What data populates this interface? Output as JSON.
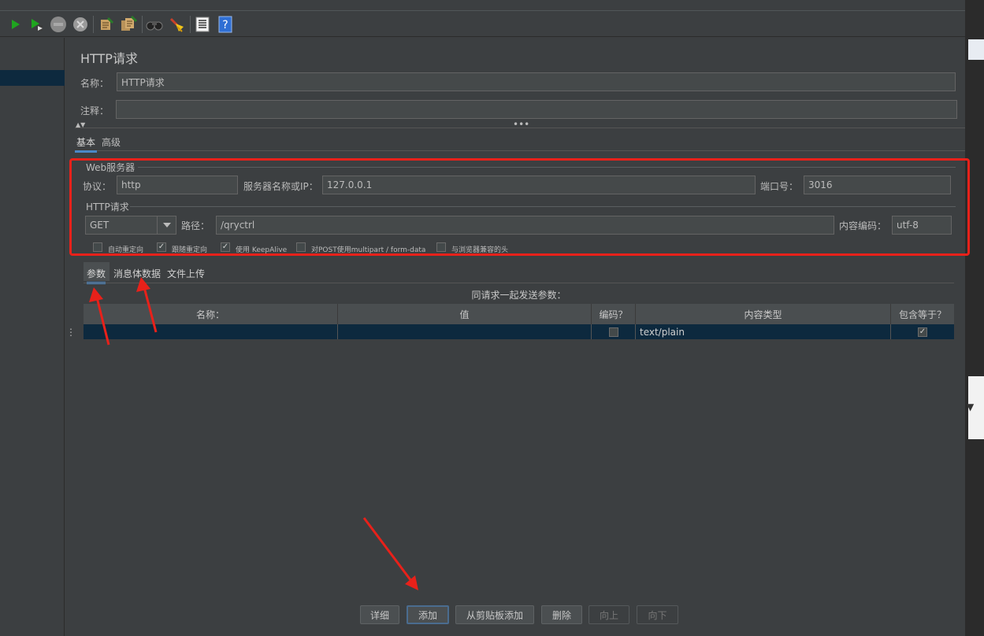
{
  "sampler": {
    "title": "HTTP请求",
    "name_label": "名称：",
    "name_value": "HTTP请求",
    "comment_label": "注释：",
    "comment_value": ""
  },
  "config_tabs": [
    "基本",
    "高级"
  ],
  "web_server": {
    "group_label": "Web服务器",
    "protocol_label": "协议：",
    "protocol_value": "http",
    "server_label": "服务器名称或IP：",
    "server_value": "127.0.0.1",
    "port_label": "端口号：",
    "port_value": "3016"
  },
  "http_request": {
    "group_label": "HTTP请求",
    "method": "GET",
    "path_label": "路径：",
    "path_value": "/qryctrl",
    "encoding_label": "内容编码：",
    "encoding_value": "utf-8"
  },
  "options": [
    {
      "label": "自动重定向",
      "checked": false
    },
    {
      "label": "跟随重定向",
      "checked": true
    },
    {
      "label": "使用 KeepAlive",
      "checked": true
    },
    {
      "label": "对POST使用multipart / form-data",
      "checked": false
    },
    {
      "label": "与浏览器兼容的头",
      "checked": false
    }
  ],
  "param_tabs": [
    "参数",
    "消息体数据",
    "文件上传"
  ],
  "params_table": {
    "caption": "同请求一起发送参数：",
    "headers": [
      "名称：",
      "值",
      "编码？",
      "内容类型",
      "包含等于？"
    ],
    "rows": [
      {
        "name": "",
        "value": "",
        "encode": false,
        "content_type": "text/plain",
        "include_equals": true
      }
    ]
  },
  "buttons": {
    "detail": "详细",
    "add": "添加",
    "add_from_clipboard": "从剪贴板添加",
    "delete": "删除",
    "up": "向上",
    "down": "向下"
  },
  "colors": {
    "background": "#3c3f41",
    "annotation_red": "#e8211a",
    "selection": "#0d293e",
    "tab_underline": "#4a88c7"
  },
  "icons": [
    "start-icon",
    "start-no-pause-icon",
    "stop-icon",
    "shutdown-icon",
    "clear-icon",
    "clear-all-icon",
    "search-icon",
    "reset-search-icon",
    "function-helper-icon",
    "help-icon"
  ]
}
